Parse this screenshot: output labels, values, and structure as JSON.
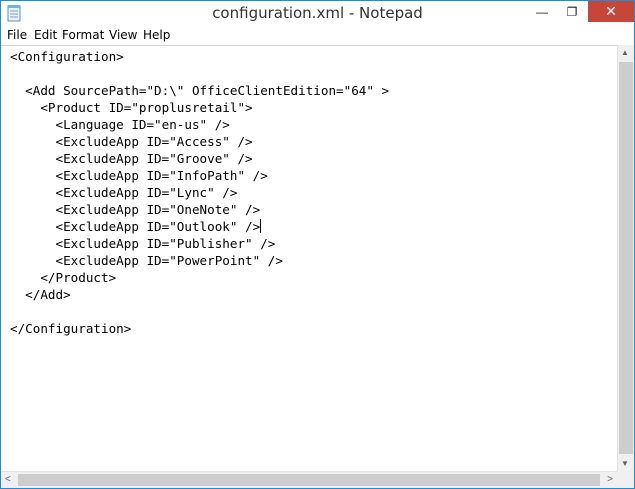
{
  "window": {
    "title": "configuration.xml - Notepad",
    "minimize_glyph": "—",
    "maximize_glyph": "❐",
    "close_glyph": "✕",
    "accent_color": "#1b8fd6",
    "close_color": "#c7463a"
  },
  "menu": [
    "File",
    "Edit",
    "Format",
    "View",
    "Help"
  ],
  "editor": {
    "caret_line": 10,
    "lines": [
      "<Configuration>",
      "",
      "  <Add SourcePath=\"D:\\\" OfficeClientEdition=\"64\" >",
      "    <Product ID=\"proplusretail\">",
      "      <Language ID=\"en-us\" />",
      "      <ExcludeApp ID=\"Access\" />",
      "      <ExcludeApp ID=\"Groove\" />",
      "      <ExcludeApp ID=\"InfoPath\" />",
      "      <ExcludeApp ID=\"Lync\" />",
      "      <ExcludeApp ID=\"OneNote\" />",
      "      <ExcludeApp ID=\"Outlook\" />",
      "      <ExcludeApp ID=\"Publisher\" />",
      "      <ExcludeApp ID=\"PowerPoint\" />",
      "    </Product>",
      "  </Add>",
      "",
      "</Configuration>"
    ]
  },
  "scrollbars": {
    "up_arrow": "▲",
    "down_arrow": "▼",
    "left_arrow": "<",
    "right_arrow": ">"
  }
}
